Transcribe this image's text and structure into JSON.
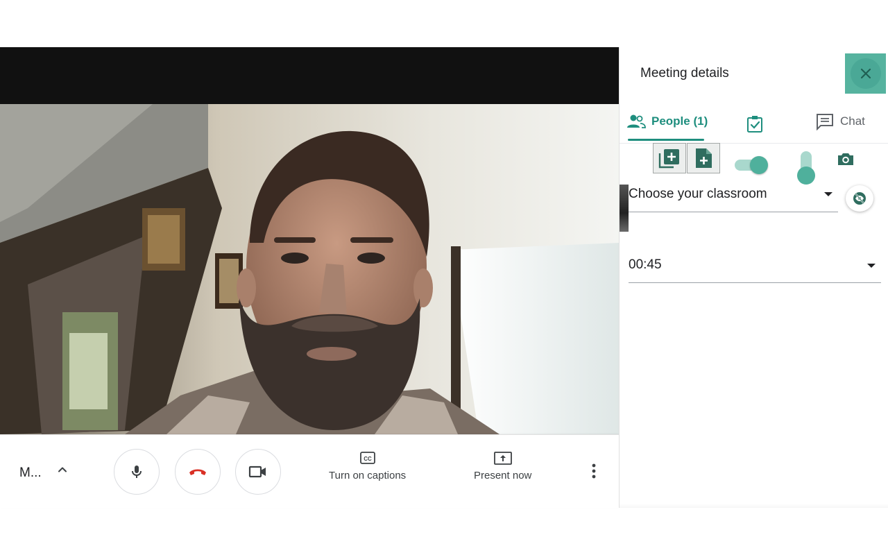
{
  "bottom_bar": {
    "meeting_name": "M...",
    "captions_label": "Turn on captions",
    "present_label": "Present now"
  },
  "panel": {
    "title": "Meeting details",
    "tabs": {
      "people_label": "People (1)",
      "chat_label": "Chat"
    },
    "extension": {
      "classroom_select_value": "Choose your classroom",
      "time_select_value": "00:45",
      "toggle_on": true
    }
  },
  "icons": {
    "mic": "microphone-icon",
    "end_call": "phone-hangup-icon",
    "camera": "video-camera-icon",
    "captions": "closed-captions-icon",
    "present": "present-screen-icon",
    "more": "more-vertical-icon",
    "close": "close-icon"
  },
  "colors": {
    "accent": "#1e8e7e",
    "extension_teal": "#4fb09c",
    "hangup_red": "#d93025"
  }
}
